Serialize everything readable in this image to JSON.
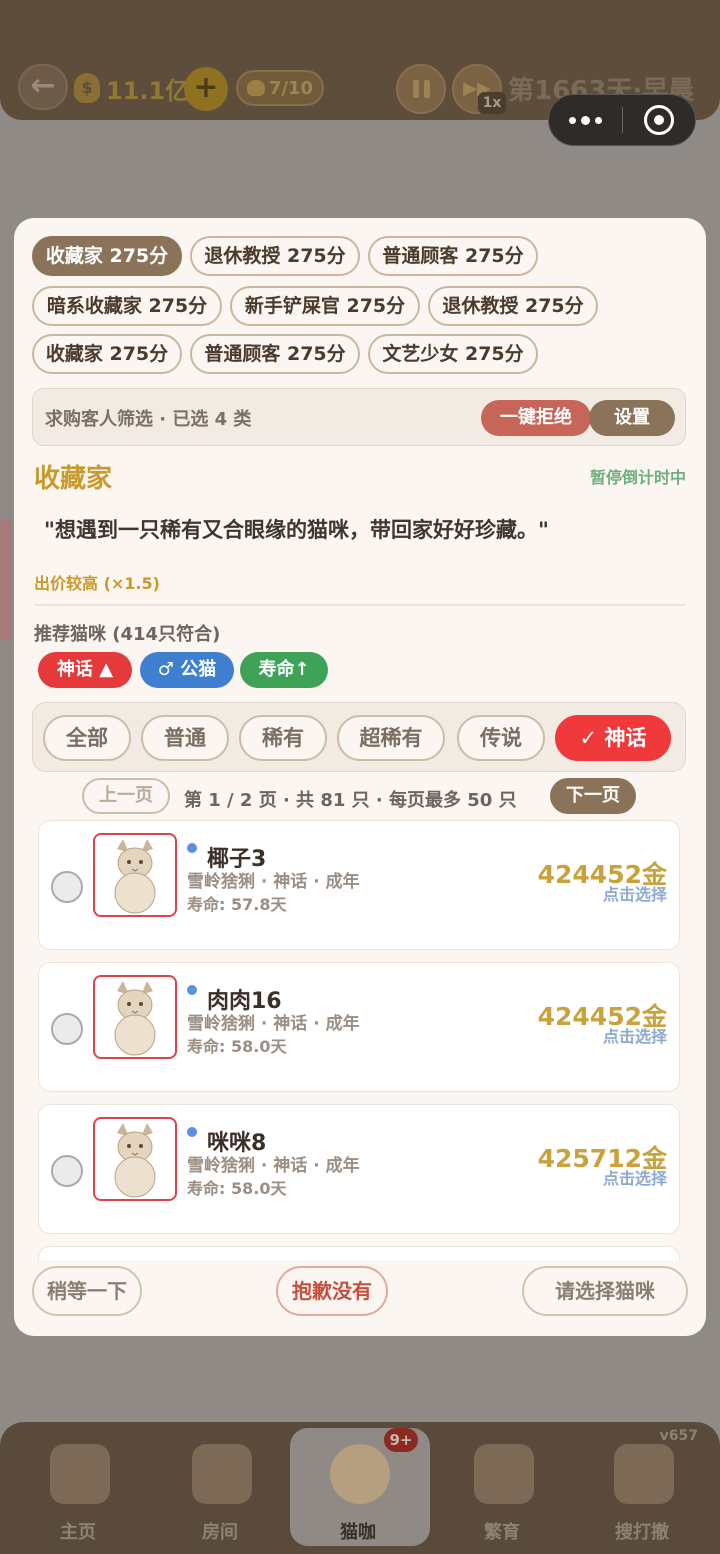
{
  "topbar": {
    "money": "11.1亿",
    "cat_count": "7/10",
    "speed": "1x",
    "day": "第1663天·早晨"
  },
  "modal": {
    "buyer_chips": [
      "收藏家 275分",
      "退休教授 275分",
      "普通顾客 275分",
      "暗系收藏家 275分",
      "新手铲屎官 275分",
      "退休教授 275分",
      "收藏家 275分",
      "普通顾客 275分",
      "文艺少女 275分"
    ],
    "filter": {
      "label": "求购客人筛选 · 已选 4 类",
      "reject_all": "一键拒绝",
      "settings": "设置"
    },
    "customer": {
      "name": "收藏家",
      "timer_note": "暂停倒计时中",
      "quote": "\"想遇到一只稀有又合眼缘的猫咪，带回家好好珍藏。\"",
      "price_note": "出价较高 (×1.5)"
    },
    "recommend": {
      "title": "推荐猫咪 (414只符合)",
      "tags": [
        "神话 ▲",
        "♂ 公猫",
        "寿命↑"
      ]
    },
    "rarity_tabs": [
      "全部",
      "普通",
      "稀有",
      "超稀有",
      "传说",
      "✓ 神话"
    ],
    "pager": {
      "prev": "上一页",
      "info": "第 1 / 2 页 · 共 81 只 · 每页最多 50 只",
      "next": "下一页"
    },
    "cats": [
      {
        "name": "椰子3",
        "meta": "雪岭猞猁 · 神话 · 成年",
        "life": "寿命: 57.8天",
        "price": "424452金",
        "hint": "点击选择"
      },
      {
        "name": "肉肉16",
        "meta": "雪岭猞猁 · 神话 · 成年",
        "life": "寿命: 58.0天",
        "price": "424452金",
        "hint": "点击选择"
      },
      {
        "name": "咪咪8",
        "meta": "雪岭猞猁 · 神话 · 成年",
        "life": "寿命: 58.0天",
        "price": "425712金",
        "hint": "点击选择"
      }
    ],
    "footer": {
      "wait": "稍等一下",
      "sorry": "抱歉没有",
      "choose": "请选择猫咪"
    }
  },
  "bottom_nav": {
    "items": [
      "主页",
      "房间",
      "猫咖",
      "繁育",
      "搜打撤"
    ],
    "badge": "9+",
    "version": "v657"
  },
  "colors": {
    "accent_gold": "#c99a2b",
    "mythic_red": "#f0393a",
    "brown": "#8a7358"
  }
}
